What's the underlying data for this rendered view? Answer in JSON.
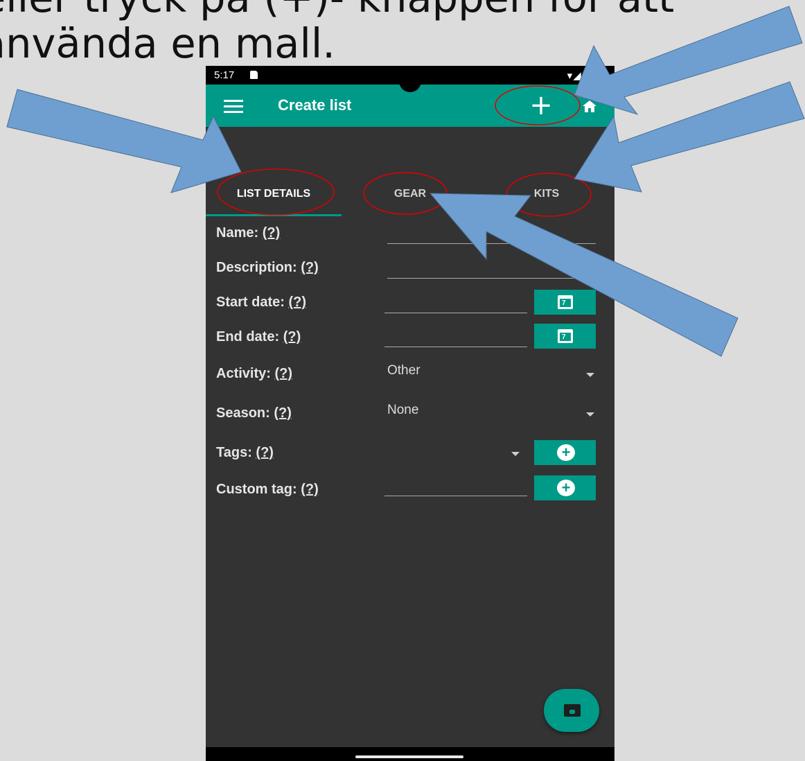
{
  "slide": {
    "line1": "eller tryck på (+)- knappen för att",
    "line2": "använda en mall."
  },
  "status_bar": {
    "time": "5:17",
    "system_icons": "▾◢▮"
  },
  "app_bar": {
    "title": "Create list",
    "add_icon": "+"
  },
  "tabs": [
    {
      "label": "LIST DETAILS",
      "active": true
    },
    {
      "label": "GEAR",
      "active": false
    },
    {
      "label": "KITS",
      "active": false
    }
  ],
  "form": {
    "help_marker": "(?)",
    "name_label": "Name:",
    "description_label": "Description:",
    "start_date_label": "Start date:",
    "end_date_label": "End date:",
    "activity_label": "Activity:",
    "activity_value": "Other",
    "season_label": "Season:",
    "season_value": "None",
    "tags_label": "Tags:",
    "custom_tag_label": "Custom tag:",
    "calendar_day": "7"
  },
  "colors": {
    "accent": "#009a88",
    "background": "#333333",
    "annotation_arrow": "#6f9fd1",
    "annotation_circle": "#e00000"
  },
  "icons": [
    "menu-icon",
    "plus-icon",
    "home-icon",
    "calendar-icon",
    "add-circle-icon",
    "save-icon"
  ]
}
